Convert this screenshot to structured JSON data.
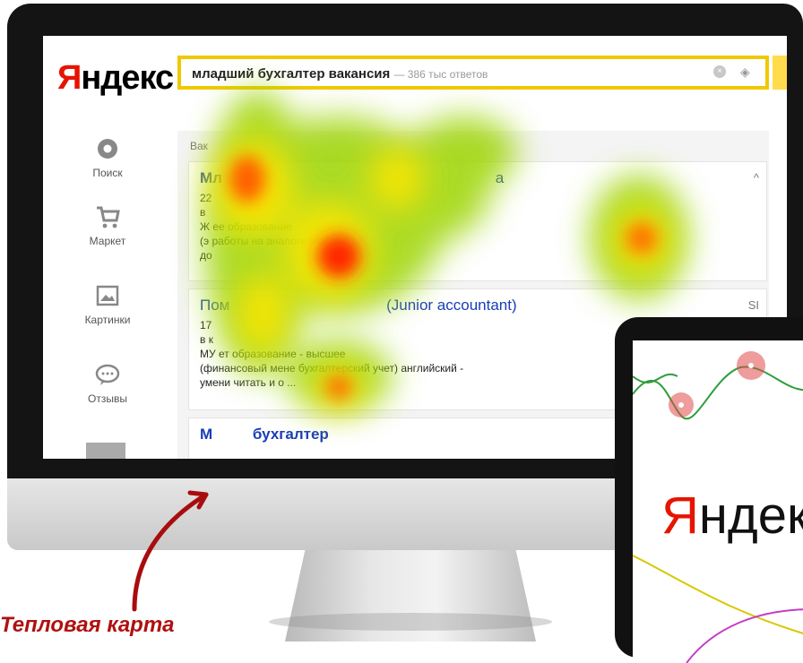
{
  "monitor": {
    "logo": {
      "first_letter": "Я",
      "rest": "ндекс"
    },
    "search": {
      "query": "младший бухгалтер вакансия",
      "count": "— 386 тыс ответов"
    },
    "sidebar": {
      "items": [
        {
          "label": "Поиск",
          "icon": "search-circle-icon"
        },
        {
          "label": "Маркет",
          "icon": "cart-icon"
        },
        {
          "label": "Картинки",
          "icon": "image-icon"
        },
        {
          "label": "Отзывы",
          "icon": "chat-icon"
        }
      ]
    },
    "results": {
      "header": "Вак",
      "items": [
        {
          "title": "Мл",
          "tail_title": "а",
          "lines": [
            "22",
            "в",
            "Ж                                ее образование",
            "(э                                 работы на аналогичной",
            "до"
          ],
          "side": "^"
        },
        {
          "title": "Пом",
          "tail_title": "(Junior accountant)",
          "lines": [
            "17",
            "в к",
            "МУ                      ет образование - высшее",
            "(финансовый мене           бухгалтерский учет) английский -",
            "умени читать и              о ..."
          ],
          "side": "SI"
        },
        {
          "title": "М",
          "tail_title": "бухгалтер",
          "lines": [],
          "side": ""
        }
      ]
    }
  },
  "tablet": {
    "logo": {
      "first_letter": "Я",
      "rest": "ндек"
    }
  },
  "annotation": {
    "caption": "Тепловая карта"
  },
  "colors": {
    "yandex_red": "#e61400",
    "search_border": "#f0c800",
    "caption": "#b01010"
  }
}
